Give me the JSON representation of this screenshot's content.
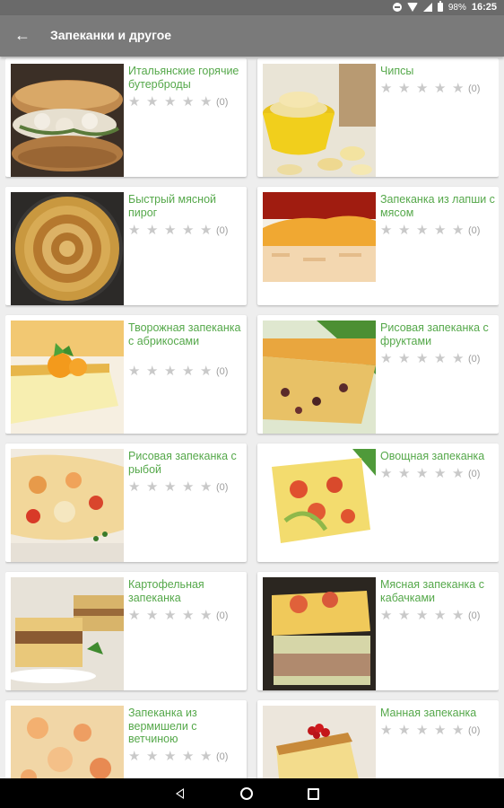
{
  "status": {
    "battery": "98%",
    "time": "16:25"
  },
  "appbar": {
    "title": "Запеканки и другое"
  },
  "recipes": [
    {
      "title": "Итальянские горячие бутерброды",
      "count": "(0)"
    },
    {
      "title": "Чипсы",
      "count": "(0)"
    },
    {
      "title": "Быстрый мясной пирог",
      "count": "(0)"
    },
    {
      "title": "Запеканка из лапши с мясом",
      "count": "(0)"
    },
    {
      "title": "Творожная запеканка с абрикосами",
      "count": "(0)"
    },
    {
      "title": "Рисовая запеканка с фруктами",
      "count": "(0)"
    },
    {
      "title": "Рисовая запеканка с рыбой",
      "count": "(0)"
    },
    {
      "title": "Овощная запеканка",
      "count": "(0)"
    },
    {
      "title": "Картофельная запеканка",
      "count": "(0)"
    },
    {
      "title": "Мясная запеканка с кабачками",
      "count": "(0)"
    },
    {
      "title": "Запеканка из вермишели с ветчиною",
      "count": "(0)"
    },
    {
      "title": "Манная запеканка",
      "count": "(0)"
    }
  ],
  "star_glyph": "★",
  "colors": {
    "accent": "#55a84a",
    "appbar": "#7a7a7a",
    "statusbar": "#6a6a6a"
  }
}
